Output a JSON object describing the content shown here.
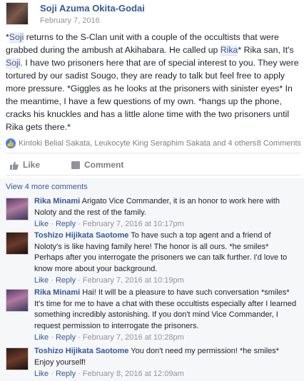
{
  "post": {
    "author": "Soji Azuma Okita-Godai",
    "date": "February 7, 2016",
    "body": {
      "mention_soji": "Soji",
      "text_1": " returns to the S-Clan unit with a couple of the occultists that were grabbed during the ambush at Akihabara. He called up ",
      "mention_rika": "Rika",
      "text_2": "* Rika san, It's ",
      "mention_soji_2": "Soji",
      "text_3": ". I have two prisoners here that are of special interest to you. They were tortured by our sadist Sougo, they are ready to talk but feel free to apply more pressure. *Giggles as he looks at the prisoners with sinister eyes* In the meantime, I have a few questions of my own. *hangs up the phone, cracks his knuckles and has a little alone time with the two prisoners until Rika gets there.*"
    },
    "reactions": {
      "icon": "thumbs-up",
      "names": "Kintoki Belial Sakata, Leukocyte King Seraphim Sakata and 4 others",
      "comment_count": "8 Comments"
    },
    "actions": {
      "like_label": "Like",
      "comment_label": "Comment"
    }
  },
  "comments_section": {
    "view_more": "View 4 more comments",
    "comments": [
      {
        "author": "Rika Minami",
        "text": "Arigato Vice Commander, it is an honor to work here with Noloty and the rest of the family.",
        "like": "Like",
        "reply": "Reply",
        "timestamp": "February 7, 2016 at 10:17pm"
      },
      {
        "author": "Toshizo Hijikata Saotome",
        "text": "To have such a top agent and a friend of Noloty's is like having family here! The honor is all ours. *he smiles* Perhaps after you interrogate the prisoners we can talk further. I'd love to know more about your background.",
        "like": "Like",
        "reply": "Reply",
        "timestamp": "February 7, 2016 at 10:19pm"
      },
      {
        "author": "Rika Minami",
        "text": "Hai! It will be a pleasure to have such conversation *smiles* It's time for me to have a chat with these occultists especially after I learned something incredibly astonishing. If you don't mind Vice Commander, I request permission to interrogate the prisoners.",
        "like": "Like",
        "reply": "Reply",
        "timestamp": "February 7, 2016 at 10:28pm"
      },
      {
        "author": "Toshizo Hijikata Saotome",
        "text": "You don't need my permission! *he smiles* Enjoy yourself!",
        "like": "Like",
        "reply": "Reply",
        "timestamp": "February 8, 2016 at 12:09am"
      }
    ]
  },
  "colors": {
    "link": "#365899",
    "meta": "#90949c",
    "like_badge": "#4080ff",
    "comments_bg": "#f6f7f9"
  }
}
